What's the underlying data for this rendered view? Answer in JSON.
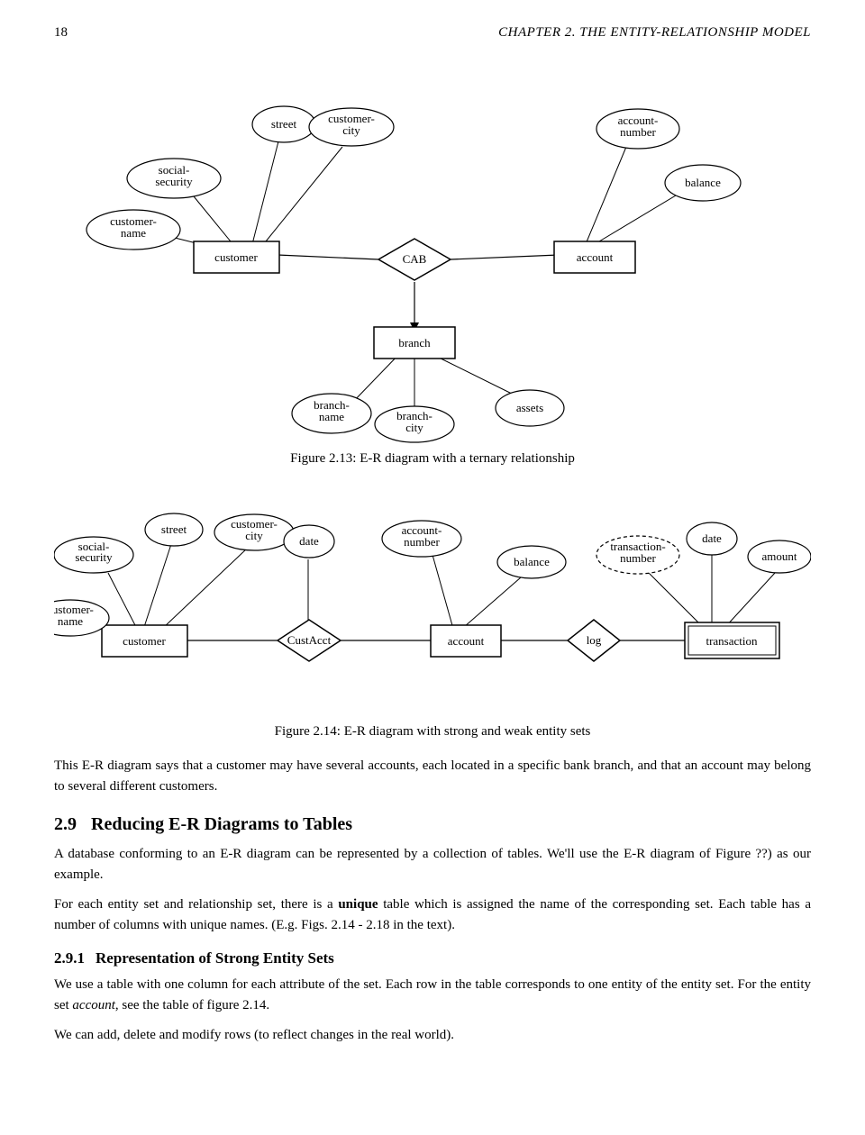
{
  "page": {
    "number": "18",
    "chapter_title": "CHAPTER 2.   THE ENTITY-RELATIONSHIP MODEL"
  },
  "figure1": {
    "caption": "Figure 2.13: E-R diagram with a ternary relationship"
  },
  "figure2": {
    "caption": "Figure 2.14: E-R diagram with strong and weak entity sets"
  },
  "paragraph1": "This E-R diagram says that a customer may have several accounts, each located in a specific bank branch, and that an account may belong to several different customers.",
  "section29": {
    "number": "2.9",
    "title": "Reducing E-R Diagrams to Tables",
    "para1": "A database conforming to an E-R diagram can be represented by a collection of tables. We'll use the E-R diagram of Figure ??) as our example.",
    "para2": "For each entity set and relationship set, there is a unique table which is assigned the name of the corresponding set. Each table has a number of columns with unique names. (E.g. Figs. 2.14 - 2.18 in the text)."
  },
  "section291": {
    "number": "2.9.1",
    "title": "Representation of Strong Entity Sets",
    "para1": "We use a table with one column for each attribute of the set. Each row in the table corresponds to one entity of the entity set. For the entity set account, see the table of figure 2.14.",
    "para2": "We can add, delete and modify rows (to reflect changes in the real world)."
  }
}
